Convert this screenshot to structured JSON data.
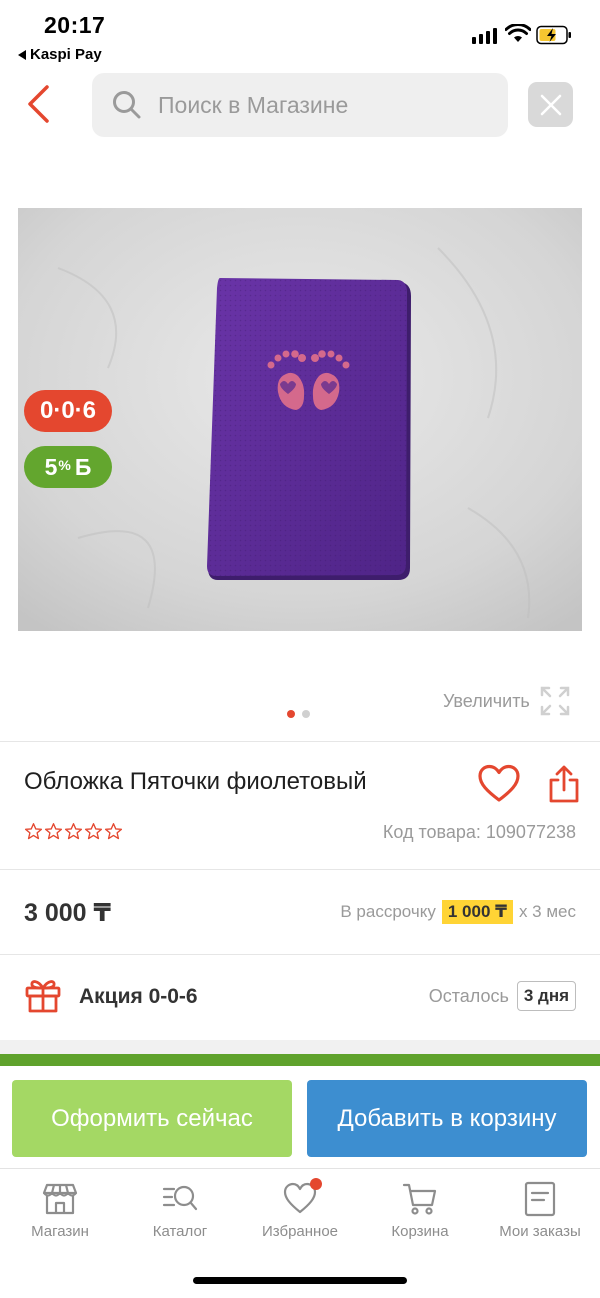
{
  "status_bar": {
    "time": "20:17",
    "back_app": "Kaspi Pay"
  },
  "search": {
    "placeholder": "Поиск в Магазине",
    "value": ""
  },
  "image": {
    "badge_006": "0·0·6",
    "bonus_percent": "5",
    "bonus_symbol": "%",
    "bonus_currency": "Б",
    "enlarge_label": "Увеличить",
    "dots_total": 2,
    "dots_active_index": 0
  },
  "product": {
    "title": "Обложка Пяточки фиолетовый",
    "rating": 0,
    "stars_max": 5,
    "sku_label": "Код товара: 109077238",
    "price": "3 000 ₸",
    "installment_prefix": "В рассрочку",
    "installment_amount": "1 000 ₸",
    "installment_suffix": "x 3 мес"
  },
  "promo": {
    "title": "Акция 0-0-6",
    "remaining_label": "Осталось",
    "remaining_value": "3 дня"
  },
  "actions": {
    "checkout_label": "Оформить сейчас",
    "add_to_cart_label": "Добавить в корзину"
  },
  "tabbar": {
    "items": [
      {
        "label": "Магазин",
        "icon": "shop-icon"
      },
      {
        "label": "Каталог",
        "icon": "catalog-search-icon"
      },
      {
        "label": "Избранное",
        "icon": "heart-icon",
        "has_notification": true
      },
      {
        "label": "Корзина",
        "icon": "cart-icon"
      },
      {
        "label": "Мои заказы",
        "icon": "orders-icon"
      }
    ]
  },
  "colors": {
    "accent_red": "#e4472f",
    "bonus_green": "#63a62e",
    "checkout_green": "#a4d864",
    "cart_blue": "#3d8ed0",
    "installment_yellow": "#ffd435"
  }
}
